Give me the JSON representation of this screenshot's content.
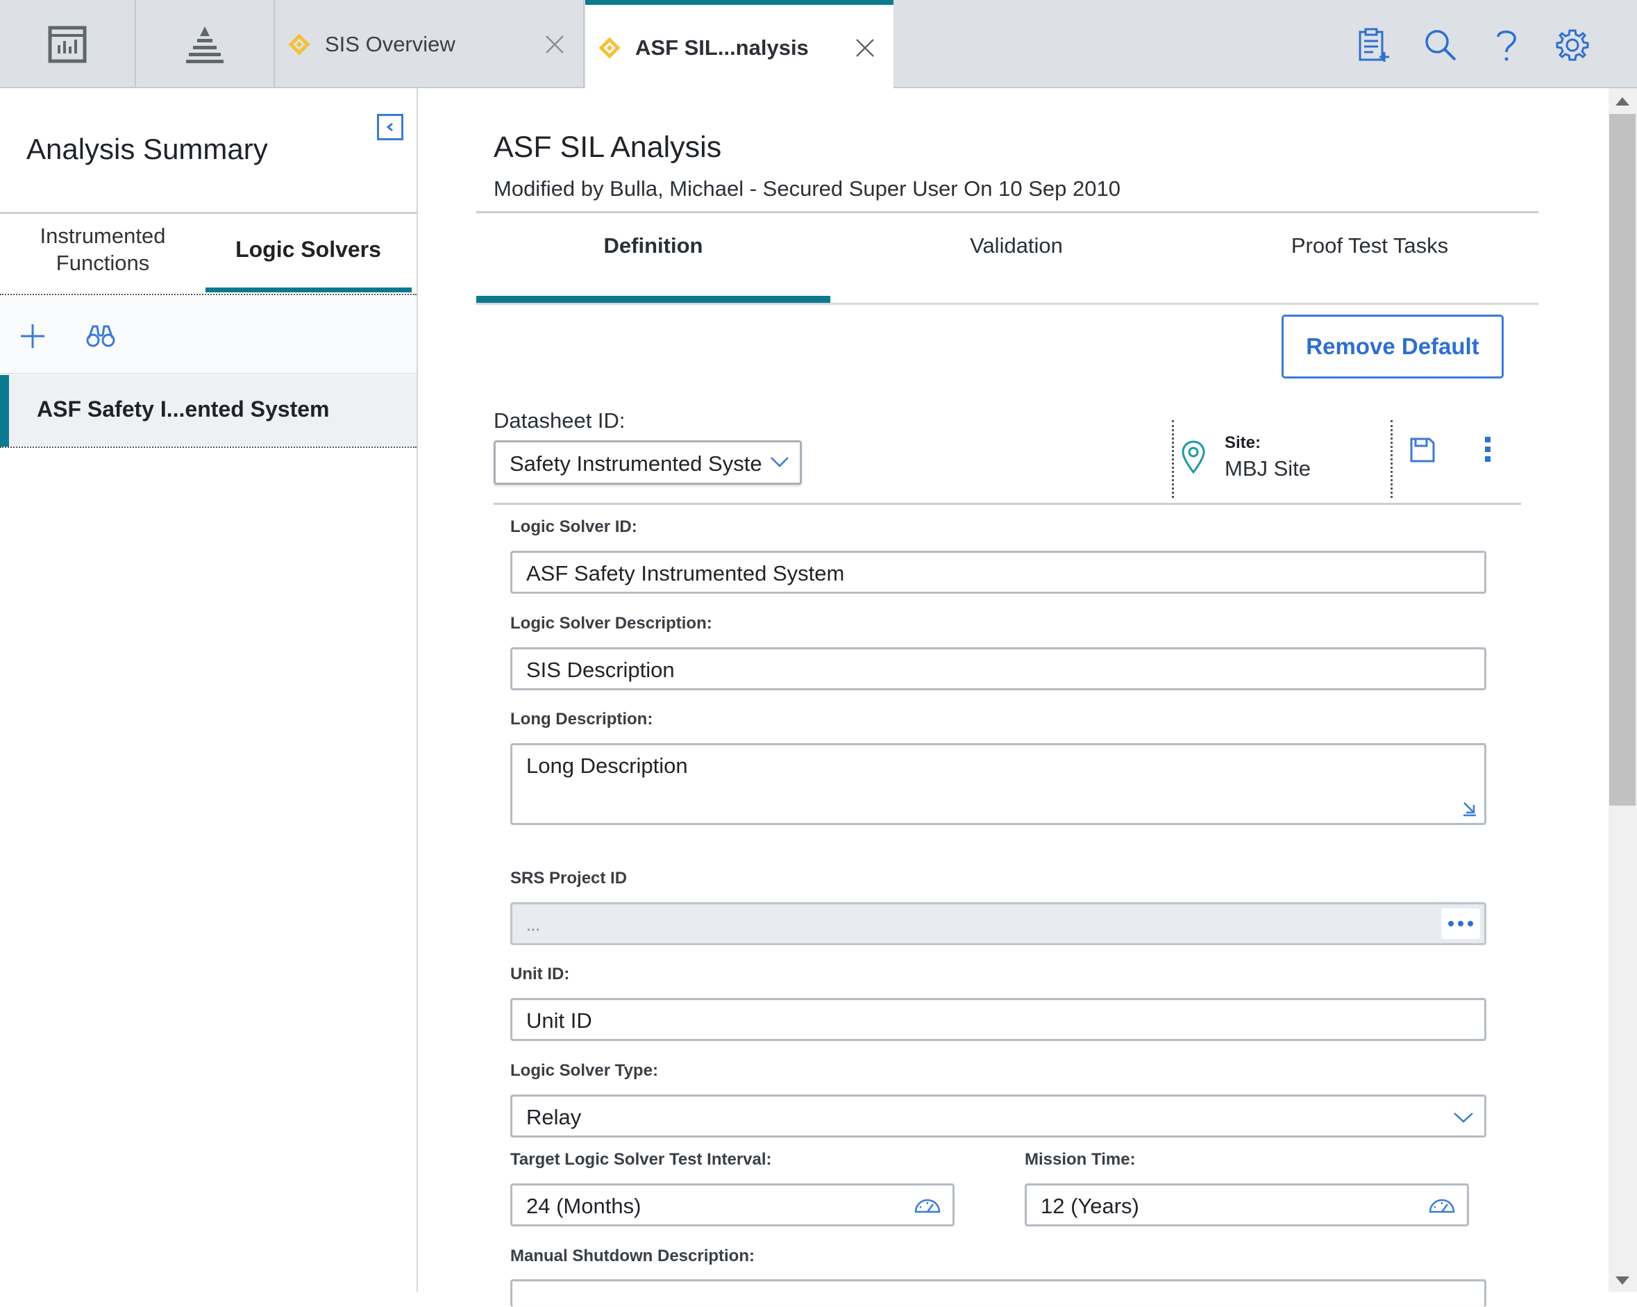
{
  "topbar": {
    "icons": [
      "dashboard-icon",
      "hierarchy-icon"
    ],
    "tabs": [
      {
        "label": "SIS Overview",
        "active": false
      },
      {
        "label": "ASF SIL...nalysis",
        "active": true
      }
    ],
    "right_icons": [
      "clipboard-add-icon",
      "search-icon",
      "help-icon",
      "gear-icon"
    ],
    "accent_color": "#0b7a8f",
    "tab_icon_color": "#f3c13a"
  },
  "left_panel": {
    "title": "Analysis Summary",
    "tabs": [
      {
        "label": "Instrumented Functions",
        "line1": "Instrumented",
        "line2": "Functions",
        "active": false
      },
      {
        "label": "Logic Solvers",
        "active": true
      }
    ],
    "toolbar_icons": [
      "plus-icon",
      "binoculars-icon"
    ],
    "items": [
      {
        "label": "ASF Safety I...ented System",
        "selected": true
      }
    ]
  },
  "main": {
    "title": "ASF SIL Analysis",
    "subtitle": "Modified by Bulla, Michael - Secured Super User On 10 Sep 2010",
    "tabs": [
      {
        "label": "Definition",
        "active": true
      },
      {
        "label": "Validation",
        "active": false
      },
      {
        "label": "Proof Test Tasks",
        "active": false
      }
    ],
    "remove_default_label": "Remove Default",
    "datasheet": {
      "label": "Datasheet ID:",
      "value": "Safety Instrumented Syste"
    },
    "site": {
      "label": "Site:",
      "value": "MBJ Site"
    },
    "fields": {
      "logic_solver_id": {
        "label": "Logic Solver ID:",
        "value": "ASF Safety Instrumented System"
      },
      "logic_solver_description": {
        "label": "Logic Solver Description:",
        "value": "SIS Description"
      },
      "long_description": {
        "label": "Long Description:",
        "value": "Long Description"
      },
      "srs_project_id": {
        "label": "SRS Project ID",
        "value": "..."
      },
      "unit_id": {
        "label": "Unit ID:",
        "value": "Unit ID"
      },
      "logic_solver_type": {
        "label": "Logic Solver Type:",
        "value": "Relay"
      },
      "target_test_interval": {
        "label": "Target Logic Solver Test Interval:",
        "value": "24 (Months)"
      },
      "mission_time": {
        "label": "Mission Time:",
        "value": "12 (Years)"
      },
      "manual_shutdown_description": {
        "label": "Manual Shutdown Description:",
        "value": ""
      }
    }
  }
}
